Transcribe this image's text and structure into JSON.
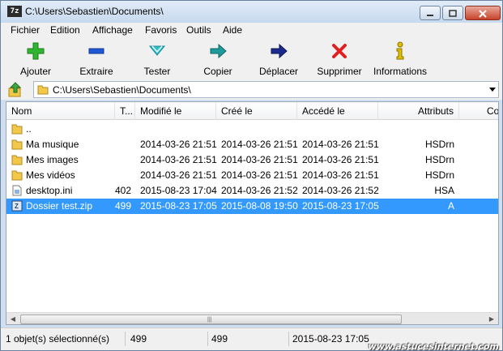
{
  "window": {
    "title": "C:\\Users\\Sebastien\\Documents\\",
    "app_icon_text": "7z"
  },
  "menu": [
    "Fichier",
    "Edition",
    "Affichage",
    "Favoris",
    "Outils",
    "Aide"
  ],
  "toolbar": [
    {
      "label": "Ajouter",
      "icon": "add-icon",
      "color": "#2fb52f"
    },
    {
      "label": "Extraire",
      "icon": "extract-icon",
      "color": "#1f57d6"
    },
    {
      "label": "Tester",
      "icon": "test-icon",
      "color": "#2fbfc8"
    },
    {
      "label": "Copier",
      "icon": "copy-icon",
      "color": "#1f9a9a"
    },
    {
      "label": "Déplacer",
      "icon": "move-icon",
      "color": "#1b2a8f"
    },
    {
      "label": "Supprimer",
      "icon": "delete-icon",
      "color": "#e02020"
    },
    {
      "label": "Informations",
      "icon": "info-icon",
      "color": "#e0c000"
    }
  ],
  "address": {
    "path": "C:\\Users\\Sebastien\\Documents\\"
  },
  "columns": [
    "Nom",
    "T...",
    "Modifié le",
    "Créé le",
    "Accédé le",
    "Attributs",
    "Co"
  ],
  "rows": [
    {
      "icon": "folder-icon",
      "name": "..",
      "size": "",
      "modified": "",
      "created": "",
      "accessed": "",
      "attributes": "",
      "selected": false
    },
    {
      "icon": "folder-icon",
      "name": "Ma musique",
      "size": "",
      "modified": "2014-03-26 21:51",
      "created": "2014-03-26 21:51",
      "accessed": "2014-03-26 21:51",
      "attributes": "HSDrn",
      "selected": false
    },
    {
      "icon": "folder-icon",
      "name": "Mes images",
      "size": "",
      "modified": "2014-03-26 21:51",
      "created": "2014-03-26 21:51",
      "accessed": "2014-03-26 21:51",
      "attributes": "HSDrn",
      "selected": false
    },
    {
      "icon": "folder-icon",
      "name": "Mes vidéos",
      "size": "",
      "modified": "2014-03-26 21:51",
      "created": "2014-03-26 21:51",
      "accessed": "2014-03-26 21:51",
      "attributes": "HSDrn",
      "selected": false
    },
    {
      "icon": "ini-file-icon",
      "name": "desktop.ini",
      "size": "402",
      "modified": "2015-08-23 17:04",
      "created": "2014-03-26 21:52",
      "accessed": "2014-03-26 21:52",
      "attributes": "HSA",
      "selected": false
    },
    {
      "icon": "zip-file-icon",
      "name": "Dossier test.zip",
      "size": "499",
      "modified": "2015-08-23 17:05",
      "created": "2015-08-08 19:50",
      "accessed": "2015-08-23 17:05",
      "attributes": "A",
      "selected": true
    }
  ],
  "status": {
    "selection": "1 objet(s) sélectionné(s)",
    "size": "499",
    "packed": "499",
    "date": "2015-08-23 17:05"
  },
  "watermark": "www.astucesinternet.com",
  "colors": {
    "selection": "#3399ff",
    "folder": "#f2c84b"
  }
}
